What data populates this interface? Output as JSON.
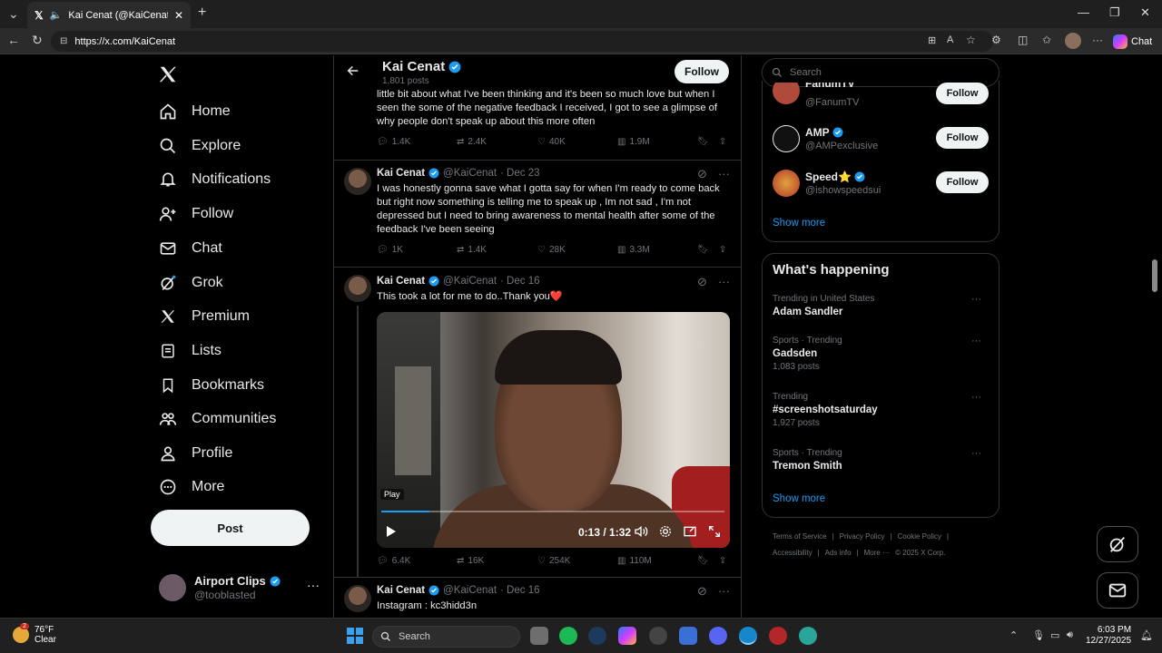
{
  "browser": {
    "tab_title": "Kai Cenat (@KaiCenat) / X",
    "url": "https://x.com/KaiCenat",
    "copilot_label": "Chat"
  },
  "nav": {
    "items": [
      {
        "label": "Home",
        "icon": "home-icon"
      },
      {
        "label": "Explore",
        "icon": "search-icon"
      },
      {
        "label": "Notifications",
        "icon": "bell-icon"
      },
      {
        "label": "Follow",
        "icon": "person-plus-icon"
      },
      {
        "label": "Chat",
        "icon": "envelope-icon"
      },
      {
        "label": "Grok",
        "icon": "grok-icon"
      },
      {
        "label": "Premium",
        "icon": "x-logo-icon"
      },
      {
        "label": "Lists",
        "icon": "list-icon"
      },
      {
        "label": "Bookmarks",
        "icon": "bookmark-icon"
      },
      {
        "label": "Communities",
        "icon": "people-icon"
      },
      {
        "label": "Profile",
        "icon": "person-icon"
      },
      {
        "label": "More",
        "icon": "more-circle-icon"
      }
    ],
    "post_label": "Post",
    "account": {
      "name": "Airport Clips",
      "handle": "@tooblasted",
      "menu": "···"
    }
  },
  "profile_header": {
    "name": "Kai Cenat",
    "posts": "1,801 posts",
    "follow_label": "Follow"
  },
  "tweets": [
    {
      "text": "little bit about what I've been thinking and it's been so much love but when I seen the some of the negative feedback I received, I got to see a glimpse of why people don't speak up about this more often",
      "replies": "1.4K",
      "reposts": "2.4K",
      "likes": "40K",
      "views": "1.9M"
    },
    {
      "name": "Kai Cenat",
      "handle": "@KaiCenat",
      "date": "· Dec 23",
      "text": "I was honestly gonna save what I gotta say for when I'm ready to come back but right now something is telling me to speak up , Im not sad , I'm not depressed but I need to bring awareness to mental health after some of the feedback I've been seeing",
      "replies": "1K",
      "reposts": "1.4K",
      "likes": "28K",
      "views": "3.3M"
    },
    {
      "name": "Kai Cenat",
      "handle": "@KaiCenat",
      "date": "· Dec 16",
      "text": "This took a lot for me to do..Thank you❤️",
      "replies": "6.4K",
      "reposts": "16K",
      "likes": "254K",
      "views": "110M",
      "video": {
        "tooltip": "Play",
        "time": "0:13 / 1:32",
        "progress": 0.14
      }
    },
    {
      "name": "Kai Cenat",
      "handle": "@KaiCenat",
      "date": "· Dec 16",
      "text": "Instagram : kc3hidd3n"
    }
  ],
  "right": {
    "search_placeholder": "Search",
    "who_to_follow": [
      {
        "name": "FanumTV",
        "handle": "@FanumTV",
        "follow": "Follow"
      },
      {
        "name": "AMP",
        "handle": "@AMPexclusive",
        "follow": "Follow"
      },
      {
        "name": "Speed⭐",
        "handle": "@ishowspeedsui",
        "follow": "Follow"
      }
    ],
    "show_more": "Show more",
    "whats_happening_title": "What's happening",
    "trends": [
      {
        "context": "Trending in United States",
        "title": "Adam Sandler",
        "count": ""
      },
      {
        "context": "Sports · Trending",
        "title": "Gadsden",
        "count": "1,083 posts"
      },
      {
        "context": "Trending",
        "title": "#screenshotsaturday",
        "count": "1,927 posts"
      },
      {
        "context": "Sports · Trending",
        "title": "Tremon Smith",
        "count": ""
      }
    ],
    "show_more_2": "Show more",
    "footer": [
      "Terms of Service",
      "|",
      "Privacy Policy",
      "|",
      "Cookie Policy",
      "|"
    ],
    "footer2": [
      "Accessibility",
      "|",
      "Ads info",
      "|",
      "More ···",
      "© 2025 X Corp."
    ]
  },
  "taskbar": {
    "weather_temp": "76°F",
    "weather_desc": "Clear",
    "weather_badge": "2",
    "search_label": "Search",
    "time": "6:03 PM",
    "date": "12/27/2025"
  },
  "colors": {
    "accent": "#1d9bf0",
    "background": "#000000",
    "border": "#2f3336",
    "muted": "#71767b"
  }
}
